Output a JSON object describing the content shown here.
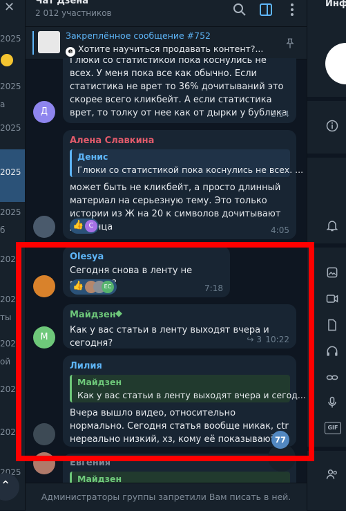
{
  "left_list": {
    "fragments": [
      "2025",
      "2025",
      "а",
      "2025",
      "2025",
      "2025",
      "б",
      "2025",
      "2025",
      "2025",
      "ты",
      "2025",
      "ой",
      "2025",
      "2025",
      "2025",
      "2025"
    ]
  },
  "header": {
    "title": "Чат Дзена",
    "subtitle": "2 012 участников"
  },
  "pinned": {
    "title": "Закреплённое сообщение #752",
    "text": "Хотите научиться продавать контент?..."
  },
  "messages": {
    "m1": {
      "avatar_letter": "Д",
      "text": "Глюки со статистикой пока коснулись не всех. У меня пока все как обычно. Если статистика не врет то 36% дочитываний это скорее всего кликбейт. А если статистика врет, то толку от нее как от дырки у бублика",
      "time": "1:54"
    },
    "m2": {
      "author": "Алена Славкина",
      "reply_name": "Денис",
      "reply_text": "Глюки со статистикой пока коснулись не всех. ...",
      "text": "может быть не кликбейт, а просто длинный материал на серьезную тему. Это только истории из Ж на 20 к символов дочитывают до конца",
      "reaction_letter": "С",
      "time": "4:05"
    },
    "m3": {
      "author": "Olesya",
      "text": "Сегодня снова в ленту не выходим?",
      "reaction_letter": "ЕС",
      "time": "7:18"
    },
    "m4": {
      "avatar_letter": "М",
      "author": "Майдзен",
      "text": "Как у вас статьи в ленту выходят вчера и сегодня?",
      "replies_count": "3",
      "time": "10:22"
    },
    "m5": {
      "author": "Лилия",
      "reply_name": "Майдзен",
      "reply_text": "Как у вас статьи в ленту выходят вчера и сегод...",
      "text": "Вчера вышло видео, относительно нормально. Сегодня статья вообще никак, ctr нереально низкий, хз, кому её показывают.",
      "time": "1"
    },
    "m6": {
      "author": "Евгения",
      "reply_name": "Майдзен"
    }
  },
  "unread_count": "77",
  "composer": {
    "notice": "Администраторы группы запретили Вам писать в ней."
  },
  "right_panel": {
    "title": "Инф",
    "gif_label": "GIF"
  },
  "colors": {
    "background": "#0e1621",
    "panel": "#17212b",
    "bubble": "#182533",
    "accent": "#5eb5f7",
    "name_alena": "#e05a6a",
    "name_green": "#6ec87a",
    "highlight": "#ff0000"
  }
}
